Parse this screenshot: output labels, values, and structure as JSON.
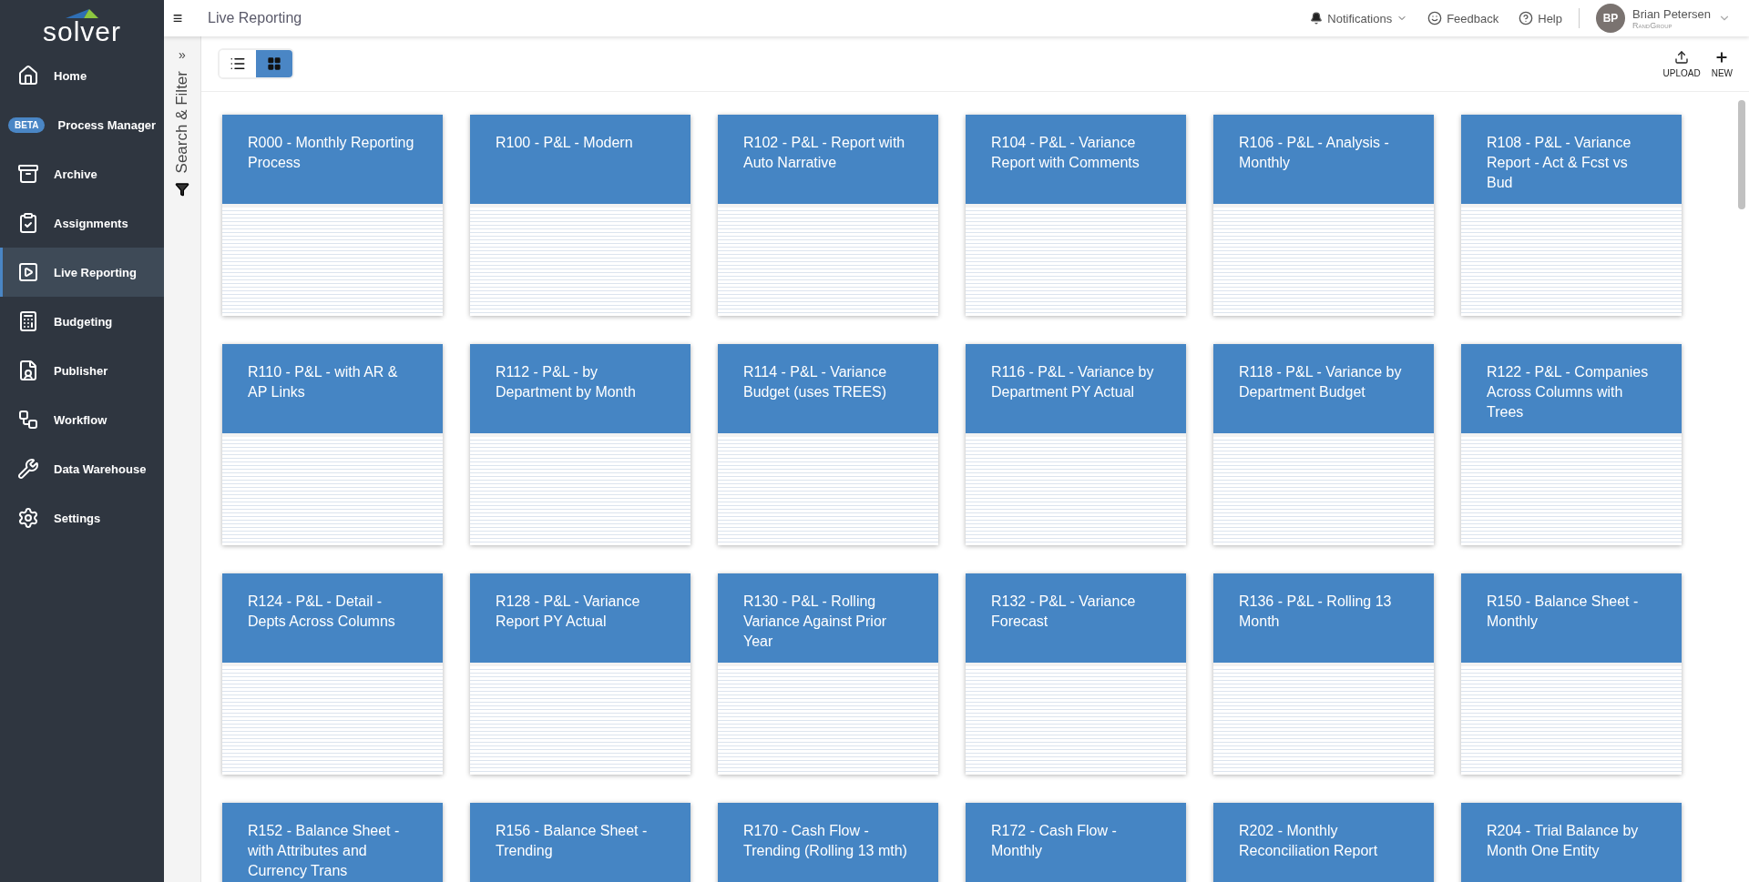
{
  "brand": {
    "name": "solver"
  },
  "sidebar": {
    "items": [
      {
        "label": "Home",
        "selected": false
      },
      {
        "label": "Process Manager",
        "badge": "BETA",
        "selected": false
      },
      {
        "label": "Archive",
        "selected": false
      },
      {
        "label": "Assignments",
        "selected": false
      },
      {
        "label": "Live Reporting",
        "selected": true
      },
      {
        "label": "Budgeting",
        "selected": false
      },
      {
        "label": "Publisher",
        "selected": false
      },
      {
        "label": "Workflow",
        "selected": false
      },
      {
        "label": "Data Warehouse",
        "selected": false
      },
      {
        "label": "Settings",
        "selected": false
      }
    ]
  },
  "header": {
    "menu_glyph": "≡",
    "title": "Live Reporting",
    "notifications": "Notifications",
    "feedback": "Feedback",
    "help": "Help",
    "user": {
      "initials": "BP",
      "name": "Brian Petersen",
      "company": "RandGroup"
    }
  },
  "filter_panel": {
    "expand_glyph": "»",
    "label": "Search & Filter"
  },
  "toolbar": {
    "views": [
      {
        "kind": "list",
        "selected": false
      },
      {
        "kind": "grid",
        "selected": true
      }
    ],
    "actions": [
      {
        "kind": "upload",
        "label": "UPLOAD"
      },
      {
        "kind": "new",
        "label": "NEW"
      }
    ]
  },
  "reports": [
    {
      "title": "R000 - Monthly Reporting Process"
    },
    {
      "title": "R100 - P&L - Modern"
    },
    {
      "title": "R102 - P&L - Report with Auto Narrative"
    },
    {
      "title": "R104 - P&L - Variance Report with Comments"
    },
    {
      "title": "R106 - P&L - Analysis - Monthly"
    },
    {
      "title": "R108 - P&L - Variance Report - Act & Fcst vs Bud"
    },
    {
      "title": "R110 - P&L - with AR & AP Links"
    },
    {
      "title": "R112 - P&L - by Department by Month"
    },
    {
      "title": "R114 - P&L - Variance Budget (uses TREES)"
    },
    {
      "title": "R116 - P&L - Variance by Department PY Actual"
    },
    {
      "title": "R118 - P&L - Variance by Department Budget"
    },
    {
      "title": "R122 - P&L - Companies Across Columns with Trees"
    },
    {
      "title": "R124 - P&L - Detail - Depts Across Columns"
    },
    {
      "title": "R128 - P&L - Variance Report PY Actual"
    },
    {
      "title": "R130 - P&L - Rolling Variance Against Prior Year"
    },
    {
      "title": "R132 - P&L - Variance Forecast"
    },
    {
      "title": "R136 - P&L - Rolling 13 Month"
    },
    {
      "title": "R150 - Balance Sheet - Monthly"
    },
    {
      "title": "R152 - Balance Sheet - with Attributes and Currency Trans"
    },
    {
      "title": "R156 - Balance Sheet - Trending"
    },
    {
      "title": "R170 - Cash Flow - Trending (Rolling 13 mth)"
    },
    {
      "title": "R172 - Cash Flow - Monthly"
    },
    {
      "title": "R202 - Monthly Reconciliation Report"
    },
    {
      "title": "R204 - Trial Balance by Month One Entity"
    }
  ]
}
